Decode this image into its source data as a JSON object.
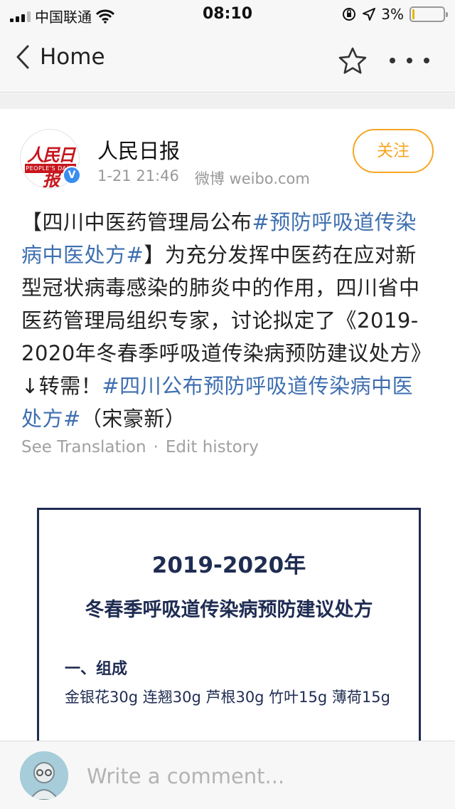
{
  "status_bar": {
    "carrier": "中国联通",
    "time": "08:10",
    "battery": "3%",
    "battery_level": 0.03,
    "icons": [
      "signal-icon",
      "wifi-icon",
      "orientation-lock-icon",
      "location-icon",
      "battery-icon"
    ]
  },
  "nav": {
    "back_label": "Home",
    "icons": [
      "chevron-left-icon",
      "star-icon",
      "more-icon"
    ]
  },
  "post": {
    "author": "人民日报",
    "avatar_logo": "人民日报",
    "avatar_logo_sub": "PEOPLE'S DAILY",
    "verified_mark": "V",
    "timestamp": "1-21 21:46",
    "source": "微博 weibo.com",
    "follow_label": "关注",
    "text_1": "【四川中医药管理局公布",
    "hashtag_1": "#预防呼吸道传染病中医处方#",
    "text_2": "】为充分发挥中医药在应对新型冠状病毒感染的肺炎中的作用，四川省中医药管理局组织专家，讨论拟定了《2019-2020年冬春季呼吸道传染病预防建议处方》↓转需！",
    "hashtag_2": "#四川公布预防呼吸道传染病中医处方#",
    "text_3": "（宋豪新）",
    "see_translation": "See Translation",
    "separator": "·",
    "edit_history": "Edit history",
    "image": {
      "title_line1": "2019-2020年",
      "title_line2": "冬春季呼吸道传染病预防建议处方",
      "section": "一、组成",
      "body": "金银花30g 连翘30g 芦根30g 竹叶15g 薄荷15g"
    }
  },
  "comment": {
    "placeholder": "Write a comment..."
  },
  "colors": {
    "hashtag": "#3e6fb0",
    "follow": "#f5a623",
    "meta": "#999999",
    "image_ink": "#1f2c52",
    "bar_bg": "#f7f7f7"
  }
}
